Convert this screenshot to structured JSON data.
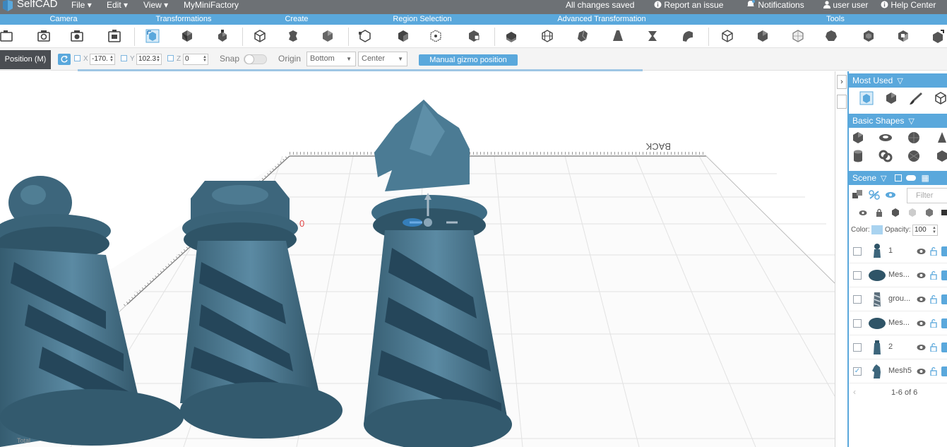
{
  "app": {
    "logo_text": "SelfCAD",
    "menu": {
      "file": "File",
      "edit": "Edit",
      "view": "View",
      "myminifactory": "MyMiniFactory"
    },
    "status": "All changes saved",
    "report_issue": "Report an issue",
    "notifications": "Notifications",
    "user": "user user",
    "help_center": "Help Center"
  },
  "categories": {
    "camera": "Camera",
    "transformations": "Transformations",
    "create": "Create",
    "region_selection": "Region Selection",
    "advanced_transformation": "Advanced Transformation",
    "tools": "Tools"
  },
  "position_bar": {
    "label": "Position (M)",
    "x_label": "X",
    "x_value": "-170.",
    "y_label": "Y",
    "y_value": "102.3",
    "z_label": "Z",
    "z_value": "0",
    "snap_label": "Snap",
    "snap_on": false,
    "origin_label": "Origin",
    "origin_vertical": "Bottom",
    "origin_horizontal": "Center",
    "manual_gizmo": "Manual gizmo position"
  },
  "viewport": {
    "back_label": "BACK",
    "axis_zero": "0",
    "total_prefix": "Total"
  },
  "right_panel": {
    "most_used": "Most Used",
    "basic_shapes": "Basic Shapes",
    "scene": "Scene",
    "filter_placeholder": "Filter",
    "color_label": "Color:",
    "color_value": "#a9d3f0",
    "opacity_label": "Opacity:",
    "opacity_value": "100",
    "pager": "1-6 of 6",
    "scene_items": [
      {
        "name": "1",
        "checked": false
      },
      {
        "name": "Mes...",
        "checked": false
      },
      {
        "name": "grou...",
        "checked": false
      },
      {
        "name": "Mes...",
        "checked": false
      },
      {
        "name": "2",
        "checked": false
      },
      {
        "name": "Mesh5",
        "checked": true
      }
    ]
  },
  "colors": {
    "menubar": "#6d7175",
    "accent": "#5aa8dc",
    "model": "#4a7890"
  }
}
